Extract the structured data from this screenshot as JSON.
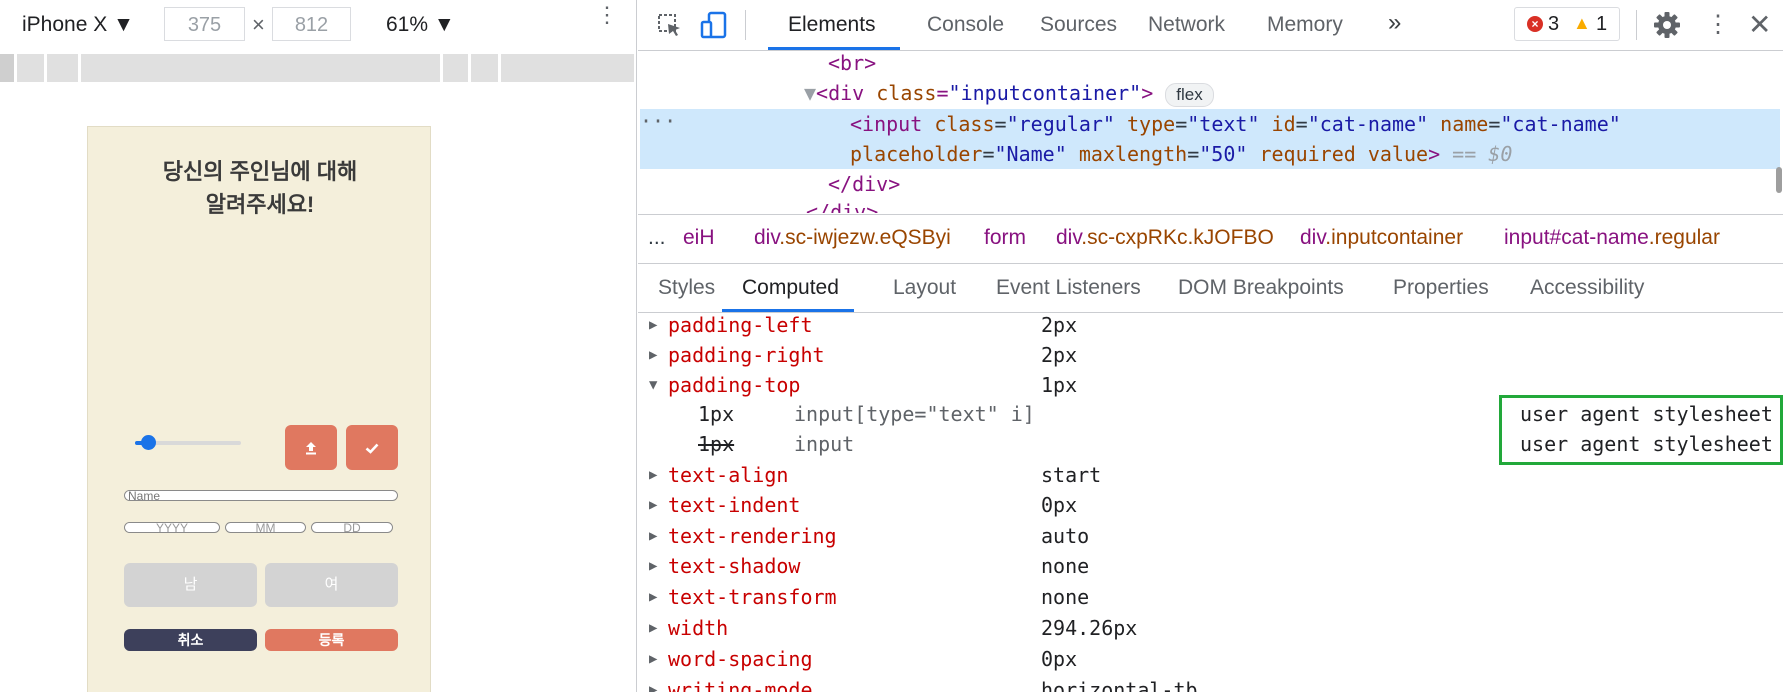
{
  "device_toolbar": {
    "device_name": "iPhone X",
    "width": "375",
    "height": "812",
    "times": "×",
    "zoom": "61%"
  },
  "app": {
    "title": "당신의 주인님에 대해 알려주세요!",
    "title_line1": "당신의 주인님에 대해",
    "title_line2": "알려주세요!",
    "slider_value": 0.12,
    "name_placeholder": "Name",
    "year_placeholder": "YYYY",
    "month_placeholder": "MM",
    "day_placeholder": "DD",
    "male_label": "남",
    "female_label": "여",
    "cancel_label": "취소",
    "submit_label": "등록",
    "colors": {
      "background": "#f4efdb",
      "accent": "#e07860",
      "dark": "#3d405b",
      "disabled": "#d3d3d3"
    }
  },
  "devtools": {
    "tabs": [
      "Elements",
      "Console",
      "Sources",
      "Network",
      "Memory"
    ],
    "more_tabs": "»",
    "error_count": "3",
    "warning_count": "1",
    "dom": {
      "br": "<br>",
      "container_open_tag": "div",
      "container_attr": "class",
      "container_attr_value": "inputcontainer",
      "flex_badge": "flex",
      "input_tag": "input",
      "input_attrs": [
        {
          "name": "class",
          "value": "regular"
        },
        {
          "name": "type",
          "value": "text"
        },
        {
          "name": "id",
          "value": "cat-name"
        },
        {
          "name": "name",
          "value": "cat-name"
        },
        {
          "name": "placeholder",
          "value": "Name"
        },
        {
          "name": "maxlength",
          "value": "50"
        }
      ],
      "input_flags": [
        "required",
        "value"
      ],
      "selected_marker": "== $0",
      "close_div": "</div>"
    },
    "breadcrumbs": [
      {
        "text": "eiH"
      },
      {
        "tag": "div",
        "cls": ".sc-iwjezw.eQSByi"
      },
      {
        "tag": "form",
        "cls": ""
      },
      {
        "tag": "div",
        "cls": ".sc-cxpRKc.kJOFBO"
      },
      {
        "tag": "div",
        "cls": ".inputcontainer"
      },
      {
        "tag": "input",
        "id": "#cat-name",
        "cls": ".regular"
      }
    ],
    "subtabs": [
      "Styles",
      "Computed",
      "Layout",
      "Event Listeners",
      "DOM Breakpoints",
      "Properties",
      "Accessibility"
    ],
    "active_subtab": "Computed",
    "computed": [
      {
        "name": "padding-left",
        "value": "2px",
        "expanded": false
      },
      {
        "name": "padding-right",
        "value": "2px",
        "expanded": false
      },
      {
        "name": "padding-top",
        "value": "1px",
        "expanded": true,
        "traces": [
          {
            "value": "1px",
            "selector": "input[type=\"text\" i]",
            "origin": "user agent stylesheet",
            "overridden": false
          },
          {
            "value": "1px",
            "selector": "input",
            "origin": "user agent stylesheet",
            "overridden": true
          }
        ]
      },
      {
        "name": "text-align",
        "value": "start",
        "expanded": false
      },
      {
        "name": "text-indent",
        "value": "0px",
        "expanded": false
      },
      {
        "name": "text-rendering",
        "value": "auto",
        "expanded": false
      },
      {
        "name": "text-shadow",
        "value": "none",
        "expanded": false
      },
      {
        "name": "text-transform",
        "value": "none",
        "expanded": false
      },
      {
        "name": "width",
        "value": "294.26px",
        "expanded": false
      },
      {
        "name": "word-spacing",
        "value": "0px",
        "expanded": false
      },
      {
        "name": "writing-mode",
        "value": "horizontal-tb",
        "expanded": false
      }
    ],
    "icons": [
      "inspect-icon",
      "device-toggle-icon",
      "more-tabs-icon",
      "error-icon",
      "warning-icon",
      "settings-icon",
      "kebab-icon",
      "close-icon"
    ]
  }
}
